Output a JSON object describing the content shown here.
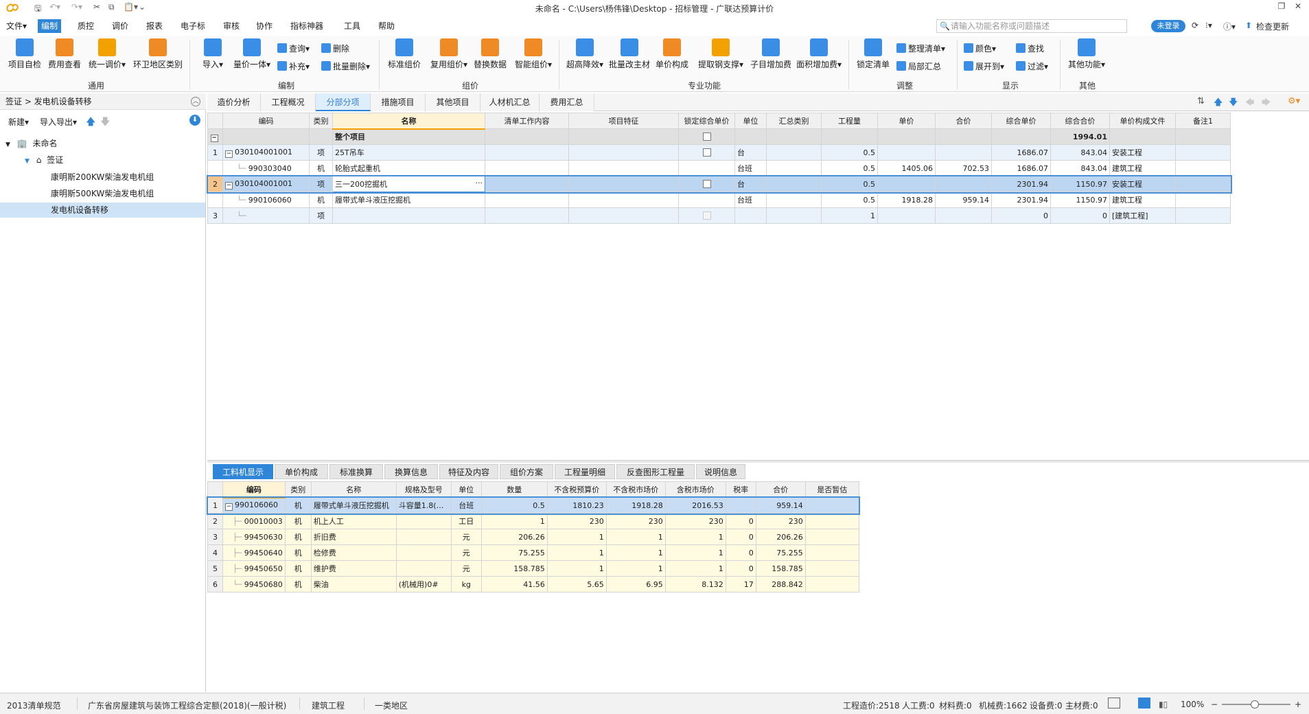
{
  "window": {
    "title": "未命名 - C:\\Users\\杨伟锋\\Desktop - 招标管理 - 广联达预算计价",
    "logo_icon": "glodon-logo-icon"
  },
  "menu": {
    "items": [
      "文件▾",
      "编制",
      "质控",
      "调价",
      "报表",
      "电子标",
      "审核",
      "协作",
      "指标神器",
      "工具",
      "帮助"
    ],
    "active": "编制",
    "search_placeholder": "请输入功能名称或问题描述",
    "login": "未登录",
    "check_update": "检查更新"
  },
  "ribbon": {
    "general": {
      "label": "通用",
      "items": [
        "项目自检",
        "费用查看",
        "统一调价",
        "环卫地区类别"
      ]
    },
    "edit": {
      "label": "编制",
      "import": "导入",
      "price_integrated": "量价一体",
      "query": "查询",
      "supplement": "补充",
      "delete": "删除",
      "batch_delete": "批量删除"
    },
    "group_price": {
      "label": "组价",
      "items": [
        "标准组价",
        "复用组价",
        "替换数据",
        "智能组价"
      ]
    },
    "special": {
      "label": "专业功能",
      "items": [
        "超高降效",
        "批量改主材",
        "单价构成",
        "提取钢支撑",
        "子目增加费",
        "面积增加费"
      ]
    },
    "adjust": {
      "label": "调整",
      "lock": "锁定清单",
      "sort": "整理清单",
      "local_sum": "局部汇总"
    },
    "display": {
      "label": "显示",
      "color": "颜色",
      "expand": "展开到",
      "find": "查找",
      "filter": "过滤"
    },
    "other": {
      "label": "其他",
      "more": "其他功能"
    }
  },
  "left": {
    "breadcrumb": "签证 > 发电机设备转移",
    "new": "新建",
    "import_export": "导入导出",
    "tree": {
      "root": "未命名",
      "group": "签证",
      "items": [
        "康明斯200KW柴油发电机组",
        "康明斯500KW柴油发电机组",
        "发电机设备转移"
      ]
    }
  },
  "tabs": [
    "造价分析",
    "工程概况",
    "分部分项",
    "措施项目",
    "其他项目",
    "人材机汇总",
    "费用汇总"
  ],
  "tabs_active": "分部分项",
  "main_table": {
    "headers": [
      "编码",
      "类别",
      "名称",
      "清单工作内容",
      "项目特征",
      "锁定综合单价",
      "单位",
      "汇总类别",
      "工程量",
      "单价",
      "合价",
      "综合单价",
      "综合合价",
      "单价构成文件",
      "备注1"
    ],
    "total": {
      "name": "整个项目",
      "total_price": "1994.01"
    },
    "rows": [
      {
        "idx": "1",
        "code": "030104001001",
        "type": "项",
        "name": "25T吊车",
        "unit": "台",
        "qty": "0.5",
        "unit_price": "",
        "price": "",
        "comp_unit": "1686.07",
        "comp_total": "843.04",
        "file": "安装工程"
      },
      {
        "idx": "",
        "code": "990303040",
        "type": "机",
        "name": "轮胎式起重机",
        "unit": "台班",
        "qty": "0.5",
        "unit_price": "1405.06",
        "price": "702.53",
        "comp_unit": "1686.07",
        "comp_total": "843.04",
        "file": "建筑工程"
      },
      {
        "idx": "2",
        "code": "030104001001",
        "type": "项",
        "name": "三一200挖掘机",
        "unit": "台",
        "qty": "0.5",
        "unit_price": "",
        "price": "",
        "comp_unit": "2301.94",
        "comp_total": "1150.97",
        "file": "安装工程"
      },
      {
        "idx": "",
        "code": "990106060",
        "type": "机",
        "name": "履带式单斗液压挖掘机",
        "unit": "台班",
        "qty": "0.5",
        "unit_price": "1918.28",
        "price": "959.14",
        "comp_unit": "2301.94",
        "comp_total": "1150.97",
        "file": "建筑工程"
      },
      {
        "idx": "3",
        "code": "",
        "type": "项",
        "name": "",
        "unit": "",
        "qty": "1",
        "unit_price": "",
        "price": "",
        "comp_unit": "0",
        "comp_total": "0",
        "file": "[建筑工程]"
      }
    ]
  },
  "bottom_tabs": [
    "工料机显示",
    "单价构成",
    "标准换算",
    "换算信息",
    "特征及内容",
    "组价方案",
    "工程量明细",
    "反查图形工程量",
    "说明信息"
  ],
  "bottom_tabs_active": "工料机显示",
  "bottom_table": {
    "headers": [
      "编码",
      "类别",
      "名称",
      "规格及型号",
      "单位",
      "数量",
      "不含税预算价",
      "不含税市场价",
      "含税市场价",
      "税率",
      "合价",
      "是否暂估"
    ],
    "rows": [
      {
        "idx": "1",
        "code": "990106060",
        "type": "机",
        "name": "履带式单斗液压挖掘机",
        "spec": "斗容量1.8(…",
        "unit": "台班",
        "qty": "0.5",
        "budget": "1810.23",
        "market": "1918.28",
        "tax_market": "2016.53",
        "rate": "",
        "total": "959.14"
      },
      {
        "idx": "2",
        "code": "00010003",
        "type": "机",
        "name": "机上人工",
        "spec": "",
        "unit": "工日",
        "qty": "1",
        "budget": "230",
        "market": "230",
        "tax_market": "230",
        "rate": "0",
        "total": "230"
      },
      {
        "idx": "3",
        "code": "99450630",
        "type": "机",
        "name": "折旧费",
        "spec": "",
        "unit": "元",
        "qty": "206.26",
        "budget": "1",
        "market": "1",
        "tax_market": "1",
        "rate": "0",
        "total": "206.26"
      },
      {
        "idx": "4",
        "code": "99450640",
        "type": "机",
        "name": "检修费",
        "spec": "",
        "unit": "元",
        "qty": "75.255",
        "budget": "1",
        "market": "1",
        "tax_market": "1",
        "rate": "0",
        "total": "75.255"
      },
      {
        "idx": "5",
        "code": "99450650",
        "type": "机",
        "name": "维护费",
        "spec": "",
        "unit": "元",
        "qty": "158.785",
        "budget": "1",
        "market": "1",
        "tax_market": "1",
        "rate": "0",
        "total": "158.785"
      },
      {
        "idx": "6",
        "code": "99450680",
        "type": "机",
        "name": "柴油",
        "spec": "(机械用)0#",
        "unit": "kg",
        "qty": "41.56",
        "budget": "5.65",
        "market": "6.95",
        "tax_market": "8.132",
        "rate": "17",
        "total": "288.842"
      }
    ]
  },
  "status": {
    "spec": "2013清单规范",
    "quota": "广东省房屋建筑与装饰工程综合定额(2018)(一般计税)",
    "project": "建筑工程",
    "area": "一类地区",
    "cost": "工程造价:2518",
    "labor": "人工费:0",
    "material": "材料费:0",
    "machine": "机械费:1662",
    "equipment": "设备费:0",
    "main_material": "主材费:0",
    "zoom": "100%"
  },
  "colors": {
    "accent": "#2f86d8",
    "selected_row": "#bcd6f2",
    "yellow_row": "#fffbe0"
  }
}
